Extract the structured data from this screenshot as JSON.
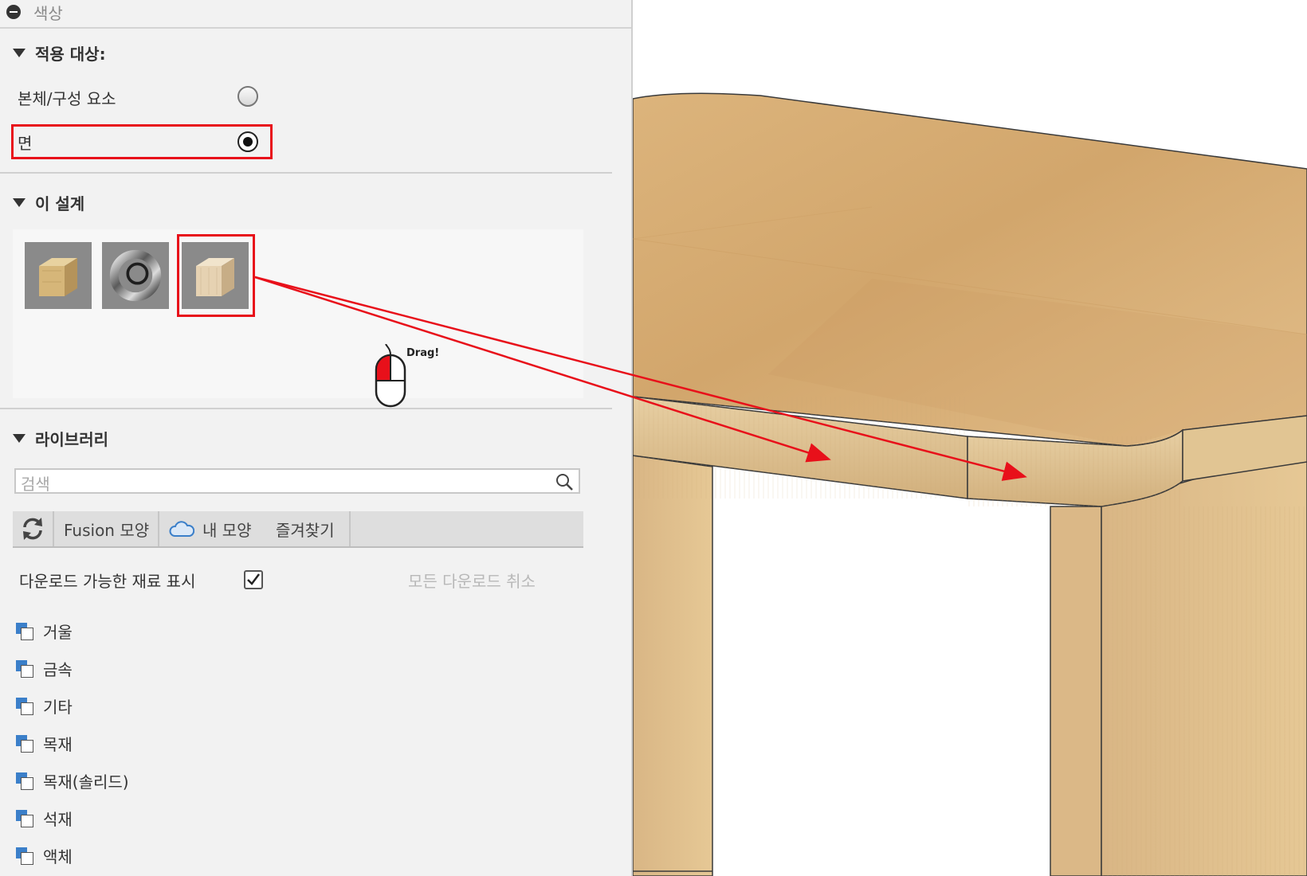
{
  "panel": {
    "title": "색상",
    "apply_to": {
      "heading": "적용 대상:",
      "options": [
        {
          "label": "본체/구성 요소",
          "selected": false
        },
        {
          "label": "면",
          "selected": true
        }
      ]
    },
    "this_design": {
      "heading": "이 설계",
      "thumbnails": [
        {
          "icon": "wood-cube-icon"
        },
        {
          "icon": "chrome-ring-icon"
        },
        {
          "icon": "light-wood-cube-icon"
        }
      ],
      "drag_hint": "Drag!"
    },
    "library": {
      "heading": "라이브러리",
      "search_placeholder": "검색",
      "tabs": [
        "Fusion 모양",
        "내 모양",
        "즐겨찾기"
      ],
      "show_downloadable_label": "다운로드 가능한 재료 표시",
      "show_downloadable_checked": true,
      "cancel_all_downloads": "모든 다운로드 취소",
      "categories": [
        "거울",
        "금속",
        "기타",
        "목재",
        "목재(솔리드)",
        "석재",
        "액체"
      ]
    }
  },
  "colors": {
    "highlight": "#e8101a",
    "panel_bg": "#f2f2f2",
    "category_icon": "#3b7fc9"
  }
}
